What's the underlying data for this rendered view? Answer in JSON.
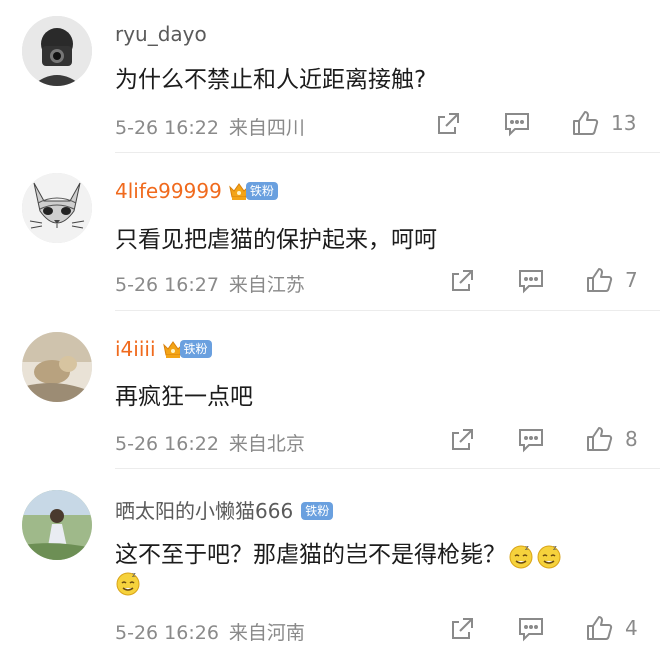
{
  "comments": [
    {
      "username": "ryu_dayo",
      "content": "为什么不禁止和人近距离接触?",
      "date": "5-26 16:22",
      "location": "来自四川",
      "likes": "13",
      "has_badge": false
    },
    {
      "username": "4life99999",
      "content": "只看见把虐猫的保护起来，呵呵",
      "date": "5-26 16:27",
      "location": "来自江苏",
      "likes": "7",
      "has_badge": true,
      "badge": "铁粉"
    },
    {
      "username": "i4iiii",
      "content": "再疯狂一点吧",
      "date": "5-26 16:22",
      "location": "来自北京",
      "likes": "8",
      "has_badge": true,
      "badge": "铁粉"
    },
    {
      "username": "晒太阳的小懒猫666",
      "content": "这不至于吧？那虐猫的岂不是得枪毙？",
      "date": "5-26 16:26",
      "location": "来自河南",
      "likes": "4",
      "has_badge": true,
      "badge": "铁粉"
    }
  ],
  "icons": {
    "share": "share-icon",
    "comment": "comment-icon",
    "like": "thumbs-up-icon",
    "crown": "crown-icon",
    "emoji": "sleepy-emoji-icon"
  },
  "colors": {
    "vip_name": "#f06a1d",
    "badge": "#6aa0df",
    "meta_text": "#8a8a8a"
  }
}
